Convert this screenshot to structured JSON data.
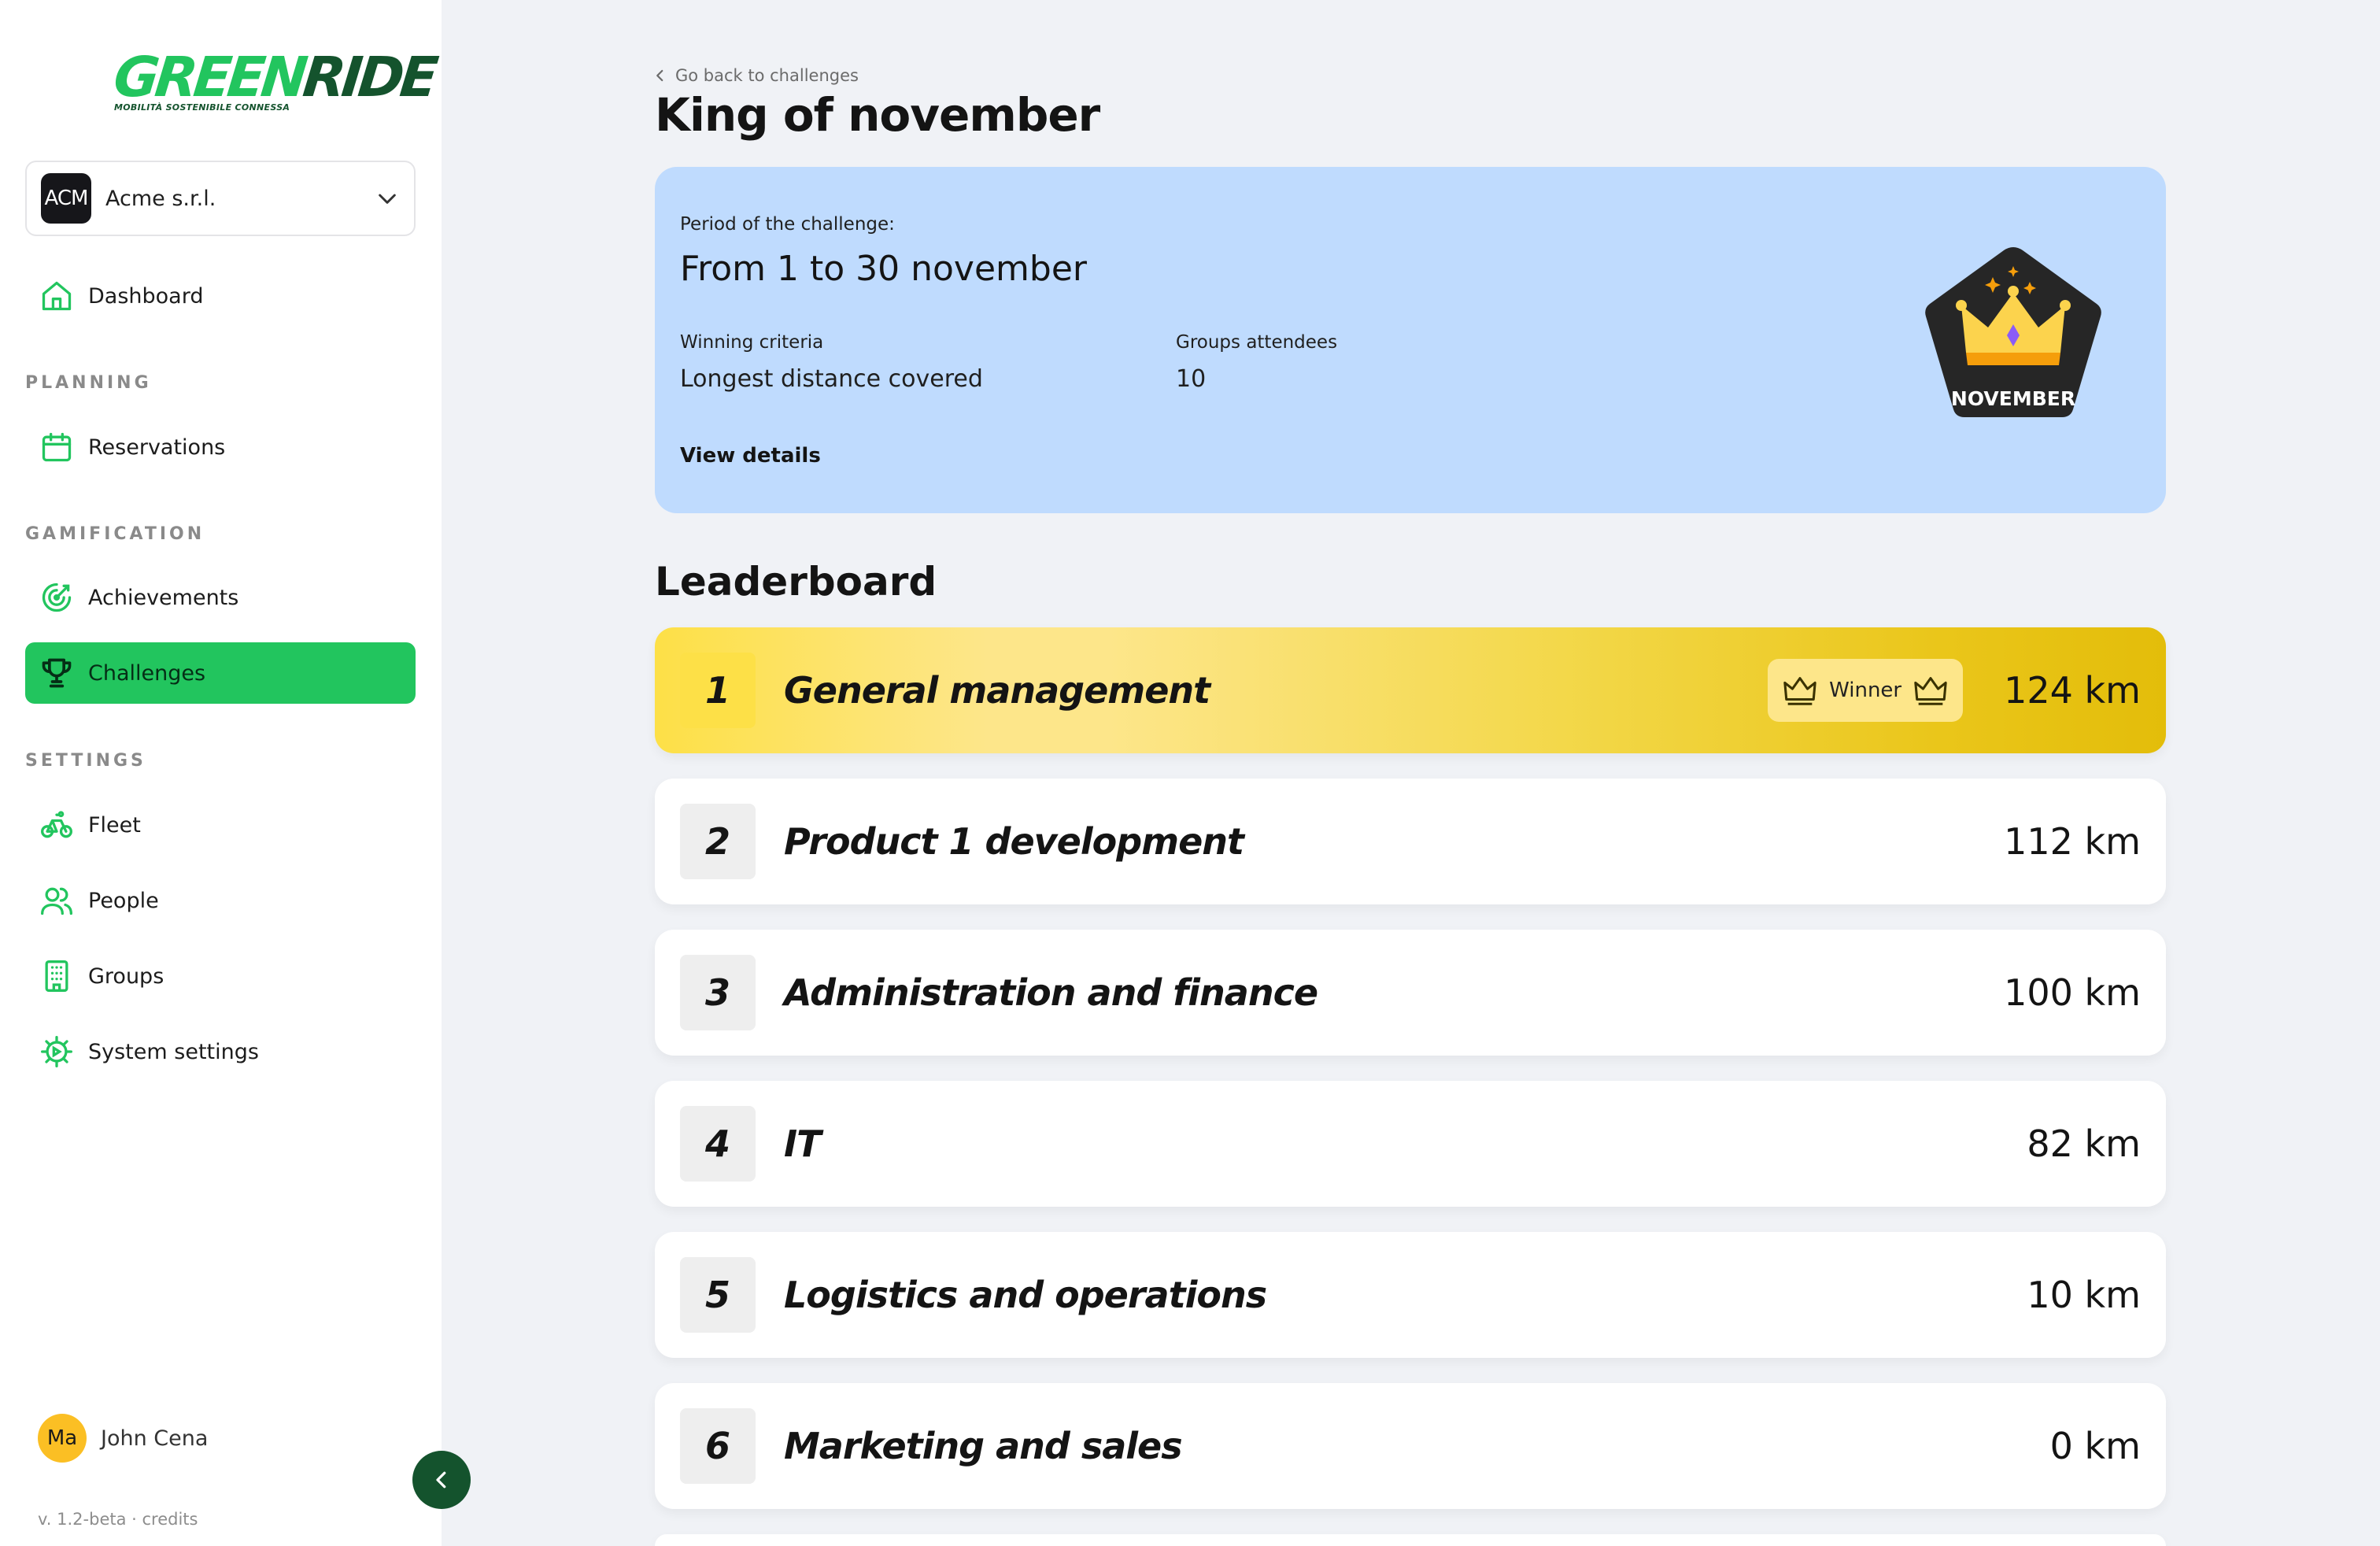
{
  "brand": {
    "logo_green": "GREEN",
    "logo_dark": "RIDE",
    "tagline": "MOBILITÀ SOSTENIBILE CONNESSA"
  },
  "org": {
    "avatar": "ACM",
    "name": "Acme s.r.l."
  },
  "nav": {
    "dashboard": "Dashboard",
    "planning_label": "PLANNING",
    "reservations": "Reservations",
    "gamification_label": "GAMIFICATION",
    "achievements": "Achievements",
    "challenges": "Challenges",
    "settings_label": "SETTINGS",
    "fleet": "Fleet",
    "people": "People",
    "groups": "Groups",
    "system_settings": "System settings"
  },
  "user": {
    "initials": "Ma",
    "name": "John Cena"
  },
  "footer": {
    "version": "v. 1.2-beta · credits"
  },
  "header": {
    "back": "Go back to challenges",
    "title": "King of november"
  },
  "challenge": {
    "period_label": "Period of the challenge:",
    "period": "From 1 to 30 november",
    "criteria_label": "Winning criteria",
    "criteria": "Longest distance covered",
    "attendees_label": "Groups attendees",
    "attendees": "10",
    "view_details": "View details",
    "badge_text": "NOVEMBER"
  },
  "leaderboard": {
    "title": "Leaderboard",
    "winner_label": "Winner",
    "rows": [
      {
        "rank": "1",
        "name": "General management",
        "distance": "124 km"
      },
      {
        "rank": "2",
        "name": "Product 1 development",
        "distance": "112 km"
      },
      {
        "rank": "3",
        "name": "Administration and finance",
        "distance": "100 km"
      },
      {
        "rank": "4",
        "name": "IT",
        "distance": "82 km"
      },
      {
        "rank": "5",
        "name": "Logistics and operations",
        "distance": "10 km"
      },
      {
        "rank": "6",
        "name": "Marketing and sales",
        "distance": "0 km"
      }
    ]
  },
  "colors": {
    "accent": "#22c55e",
    "dark_green": "#14532d",
    "card_blue": "#bfdbfe",
    "gold": "#fde047"
  }
}
